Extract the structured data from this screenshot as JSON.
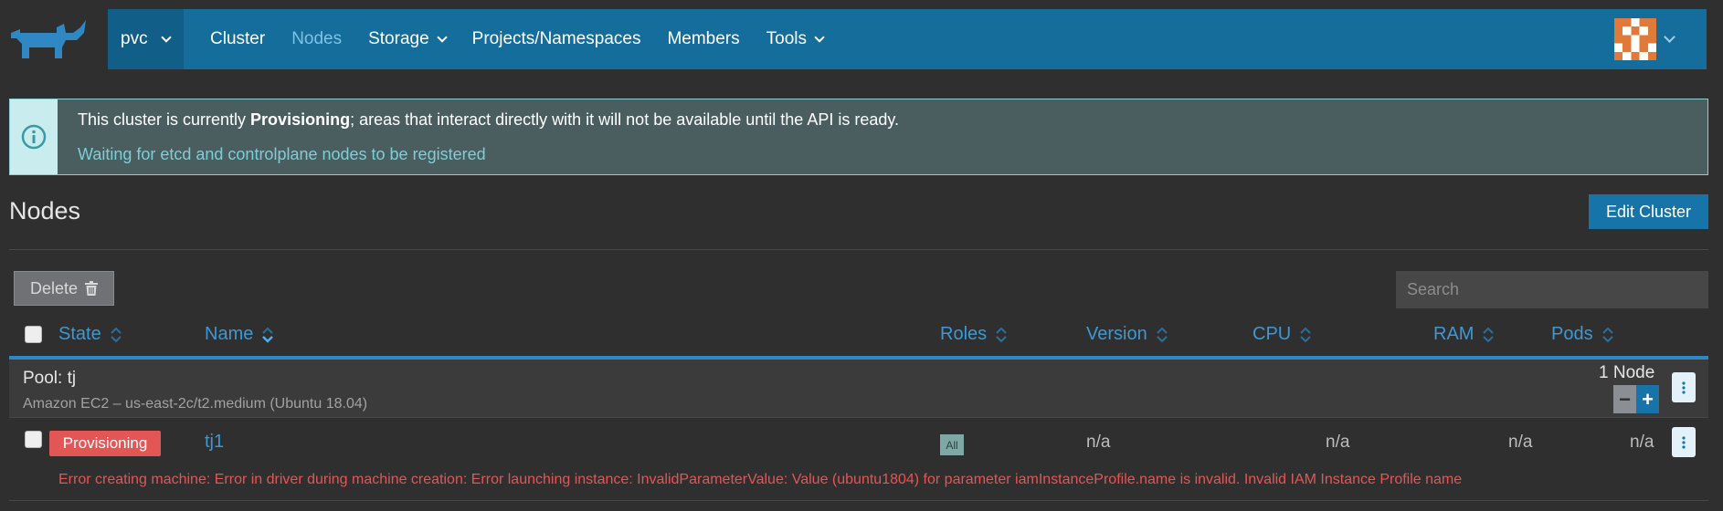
{
  "nav": {
    "cluster": "pvc",
    "items": [
      {
        "label": "Cluster"
      },
      {
        "label": "Nodes"
      },
      {
        "label": "Storage"
      },
      {
        "label": "Projects/Namespaces"
      },
      {
        "label": "Members"
      },
      {
        "label": "Tools"
      }
    ]
  },
  "banner": {
    "prefix": "This cluster is currently ",
    "state": "Provisioning",
    "suffix": "; areas that interact directly with it will not be available until the API is ready.",
    "detail": "Waiting for etcd and controlplane nodes to be registered"
  },
  "page": {
    "title": "Nodes",
    "edit_cluster": "Edit Cluster",
    "delete": "Delete",
    "search_placeholder": "Search"
  },
  "table": {
    "headers": [
      "State",
      "Name",
      "Roles",
      "Version",
      "CPU",
      "RAM",
      "Pods"
    ],
    "pool": {
      "title": "Pool: tj",
      "subtitle": "Amazon EC2 – us-east-2c/t2.medium (Ubuntu 18.04)",
      "count": "1 Node",
      "minus": "−",
      "plus": "+"
    },
    "rows": [
      {
        "state": "Provisioning",
        "name": "tj1",
        "role": "All",
        "version": "n/a",
        "cpu": "n/a",
        "ram": "n/a",
        "pods": "n/a",
        "error": "Error creating machine: Error in driver during machine creation: Error launching instance: InvalidParameterValue: Value (ubuntu1804) for parameter iamInstanceProfile.name is invalid. Invalid IAM Instance Profile name"
      }
    ]
  },
  "colors": {
    "nav_bg": "#146d9a",
    "accent": "#3d98d3",
    "error": "#e25656",
    "banner_bg": "#4a5d5f"
  }
}
